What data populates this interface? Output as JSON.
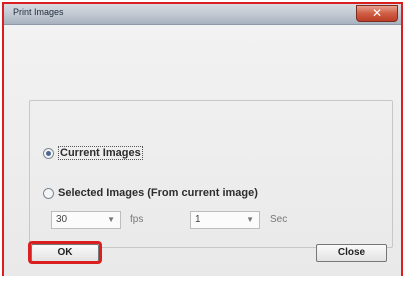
{
  "window": {
    "title": "Print Images",
    "close_glyph": "✕",
    "close_icon": "close-icon"
  },
  "options": {
    "current_images_label": "Current Images",
    "current_images_selected": true,
    "selected_images_label": "Selected Images (From current image)",
    "selected_images_selected": false
  },
  "fps": {
    "value": "30",
    "unit": "fps",
    "arrow_glyph": "▼"
  },
  "seconds": {
    "value": "1",
    "unit": "Sec",
    "arrow_glyph": "▼"
  },
  "buttons": {
    "ok_label": "OK",
    "close_label": "Close"
  },
  "colors": {
    "highlight": "#d91f1f"
  }
}
